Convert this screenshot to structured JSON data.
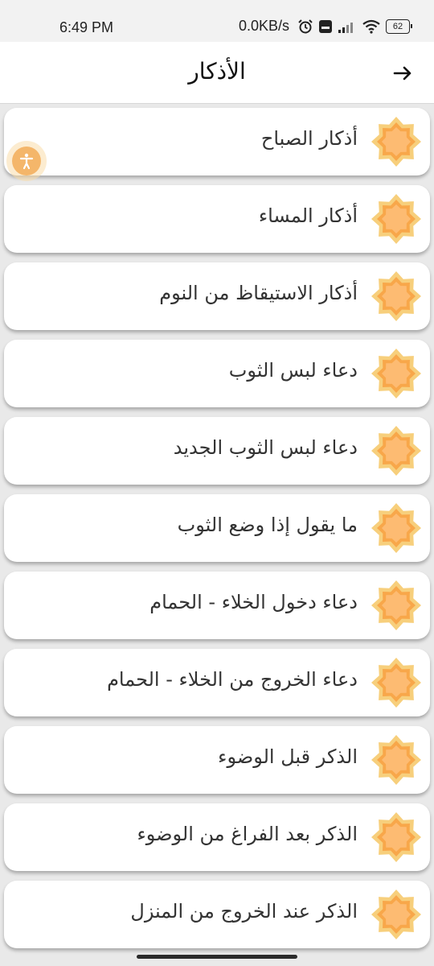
{
  "status_bar": {
    "time": "6:49 PM",
    "net_speed": "0.0KB/s",
    "battery": "62"
  },
  "header": {
    "title": "الأذكار",
    "back_icon": "arrow-right-icon"
  },
  "items": [
    {
      "label": "أذكار الصباح",
      "icon": "star-icon"
    },
    {
      "label": "أذكار المساء",
      "icon": "star-icon"
    },
    {
      "label": "أذكار الاستيقاظ من النوم",
      "icon": "star-icon"
    },
    {
      "label": "دعاء لبس الثوب",
      "icon": "star-icon"
    },
    {
      "label": "دعاء لبس الثوب الجديد",
      "icon": "star-icon"
    },
    {
      "label": "ما يقول إذا وضع الثوب",
      "icon": "star-icon"
    },
    {
      "label": "دعاء دخول الخلاء - الحمام",
      "icon": "star-icon"
    },
    {
      "label": "دعاء الخروج من الخلاء - الحمام",
      "icon": "star-icon"
    },
    {
      "label": "الذكر قبل الوضوء",
      "icon": "star-icon"
    },
    {
      "label": "الذكر بعد الفراغ من الوضوء",
      "icon": "star-icon"
    },
    {
      "label": "الذكر عند الخروج من المنزل",
      "icon": "star-icon"
    }
  ],
  "colors": {
    "star_outer": "#f7cf7c",
    "star_inner": "#f8a74a",
    "accessibility": "#f4b66a"
  }
}
